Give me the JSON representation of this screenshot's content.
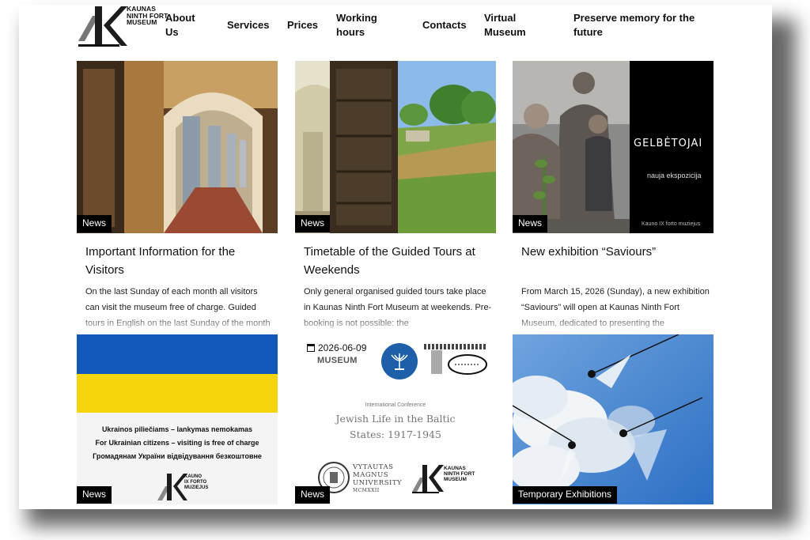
{
  "brand": {
    "logo_lines": [
      "KAUNAS",
      "NINTH FORT",
      "MUSEUM"
    ]
  },
  "nav": {
    "items": [
      {
        "label_lines": [
          "About",
          "Us"
        ]
      },
      {
        "label_lines": [
          "Services"
        ]
      },
      {
        "label_lines": [
          "Prices"
        ]
      },
      {
        "label_lines": [
          "Working",
          "hours"
        ]
      },
      {
        "label_lines": [
          "Contacts"
        ]
      },
      {
        "label_lines": [
          "Virtual",
          "Museum"
        ]
      },
      {
        "label_lines": [
          "Preserve memory for the",
          "future"
        ]
      }
    ]
  },
  "cards": [
    {
      "badge": "News",
      "title": "Important Information for the Visitors",
      "excerpt": "On the last Sunday of each month all visitors can visit the museum free of charge. Guided tours in English on the last Sunday of the month"
    },
    {
      "badge": "News",
      "title": "Timetable of the Guided Tours at Weekends",
      "excerpt": "Only general organised guided tours take place in Kaunas Ninth Fort Museum at weekends. Pre-booking is not possible: the"
    },
    {
      "badge": "News",
      "title": "New exhibition “Saviours”",
      "excerpt": "From March 15, 2026 (Sunday), a new exhibition “Saviours” will open at Kaunas Ninth Fort Museum, dedicated to presenting the",
      "poster_title": "GELBĖTOJAI",
      "poster_subtitle": "nauja ekspozicija",
      "poster_credit": "Kauno IX forto muziejus"
    },
    {
      "badge": "News",
      "poster_lines": [
        "Ukrainos piliečiams – lankymas nemokamas",
        "For Ukrainian citizens – visiting is free of charge",
        "Громадянам України відвідування безкоштовне"
      ],
      "poster_logo_lines": [
        "KAUNO",
        "IX FORTO",
        "MUZIEJUS"
      ]
    },
    {
      "badge": "News",
      "date": "2026-06-09",
      "conf_label": "International Conference",
      "conf_title_lines": [
        "Jewish Life in the Baltic",
        "States: 1917-1945"
      ],
      "museum_word": "MUSEUM",
      "university_lines": [
        "VYTAUTAS",
        "MAGNUS",
        "UNIVERSITY",
        "MCMXXII"
      ],
      "partner_logo_lines": [
        "KAUNAS",
        "NINTH FORT",
        "MUSEUM"
      ]
    },
    {
      "badge": "Temporary Exhibitions"
    }
  ],
  "colors": {
    "ukraine_blue": "#1357b8",
    "ukraine_yellow": "#f6d40c",
    "badge_bg": "#000000",
    "sky_blue": "#3a7fd0"
  }
}
